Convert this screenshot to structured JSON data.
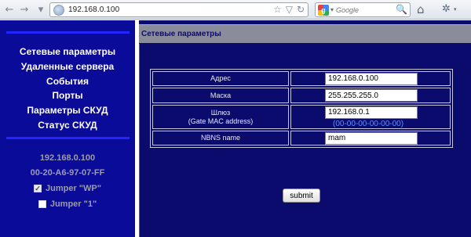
{
  "browser": {
    "back_glyph": "←",
    "forward_glyph": "→",
    "url": "192.168.0.100",
    "url_icons": [
      "☆",
      "▽",
      "↻"
    ],
    "search_engine_letter": "g",
    "search_placeholder": "Google",
    "search_go_glyph": "🔍",
    "home_glyph": "⌂",
    "addon_glyph": "✲",
    "dropdown_glyph": "▾"
  },
  "sidebar": {
    "menu": [
      {
        "label": "Сетевые параметры"
      },
      {
        "label": "Удаленные сервера"
      },
      {
        "label": "События"
      },
      {
        "label": "Порты"
      },
      {
        "label": "Параметры СКУД"
      },
      {
        "label": "Статус СКУД"
      }
    ],
    "ip": "192.168.0.100",
    "mac": "00-20-A6-97-07-FF",
    "jumpers": [
      {
        "label": "Jumper \"WP\"",
        "checked": true,
        "check_glyph": "✓"
      },
      {
        "label": "Jumper \"1\"",
        "checked": false,
        "check_glyph": ""
      }
    ],
    "colors": {
      "background": "#0b0b99",
      "accent_line": "#2424ff"
    }
  },
  "main": {
    "title": "Сетевые параметры",
    "fields": [
      {
        "label": "Адрес",
        "value": "192.168.0.100"
      },
      {
        "label": "Маска",
        "value": "255.255.255.0"
      },
      {
        "label": "Шлюз",
        "sublabel": "(Gate MAC address)",
        "value": "192.168.0.1",
        "mac": "(00-00-00-00-00-00)"
      },
      {
        "label": "NBNS name",
        "value": "mam"
      }
    ],
    "submit_label": "submit",
    "colors": {
      "background": "#0b0b6e",
      "header": "#8a8c9c",
      "mac_text": "#5f8fff"
    }
  }
}
